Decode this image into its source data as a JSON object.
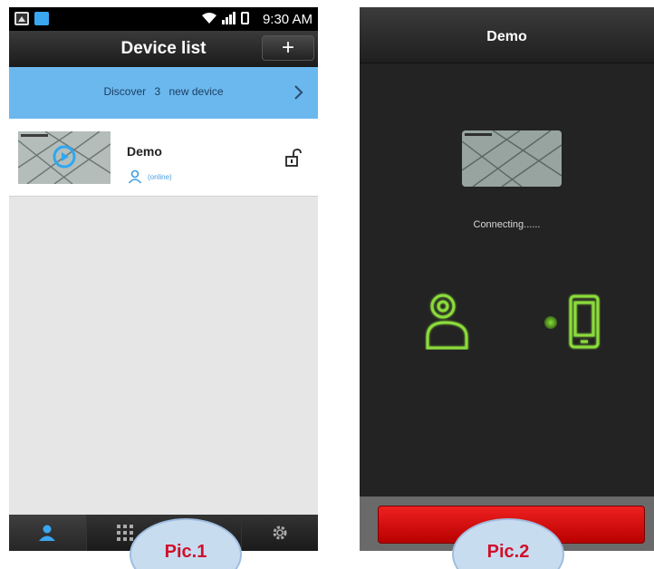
{
  "pic1": {
    "status_bar": {
      "time": "9:30 AM"
    },
    "header": {
      "title": "Device list",
      "add_label": "+"
    },
    "discover": {
      "prefix": "Discover",
      "count": "3",
      "suffix": "new device"
    },
    "device": {
      "name": "Demo",
      "status": "(online)"
    },
    "tabs": [
      {
        "icon": "user-icon",
        "active": true
      },
      {
        "icon": "grid-icon",
        "active": false
      },
      {
        "icon": "gallery-icon",
        "active": false
      },
      {
        "icon": "gear-icon",
        "active": false
      }
    ]
  },
  "pic2": {
    "header": {
      "title": "Demo"
    },
    "connecting_text": "Connecting......"
  },
  "captions": {
    "pic1": "Pic.1",
    "pic2": "Pic.2"
  },
  "colors": {
    "discover_bar": "#6bb8ef",
    "accent_blue": "#39a8f0",
    "neon_green": "#8bdc3b",
    "red_button": "#e01010",
    "caption_text": "#d0102a"
  }
}
